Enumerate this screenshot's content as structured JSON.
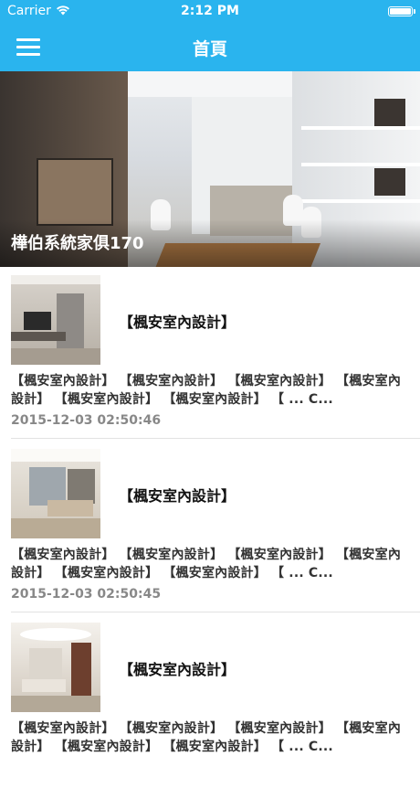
{
  "status_bar": {
    "carrier": "Carrier",
    "wifi_icon": "wifi-icon",
    "time": "2:12 PM",
    "battery_icon": "battery-icon"
  },
  "nav": {
    "title": "首頁",
    "menu_icon": "hamburger-menu-icon"
  },
  "hero": {
    "caption": "樺伯系統家俱170"
  },
  "articles": [
    {
      "title": "【楓安室內設計】",
      "excerpt": "【楓安室內設計】 【楓安室內設計】 【楓安室內設計】 【楓安室內設計】 【楓安室內設計】 【楓安室內設計】 【 ... C...",
      "date": "2015-12-03 02:50:46"
    },
    {
      "title": "【楓安室內設計】",
      "excerpt": "【楓安室內設計】 【楓安室內設計】 【楓安室內設計】 【楓安室內設計】 【楓安室內設計】 【楓安室內設計】 【 ... C...",
      "date": "2015-12-03 02:50:45"
    },
    {
      "title": "【楓安室內設計】",
      "excerpt": "【楓安室內設計】 【楓安室內設計】 【楓安室內設計】 【楓安室內設計】 【楓安室內設計】 【楓安室內設計】 【 ... C...",
      "date": ""
    }
  ],
  "colors": {
    "accent": "#2ab4ee",
    "text": "#222222",
    "muted": "#888888"
  }
}
